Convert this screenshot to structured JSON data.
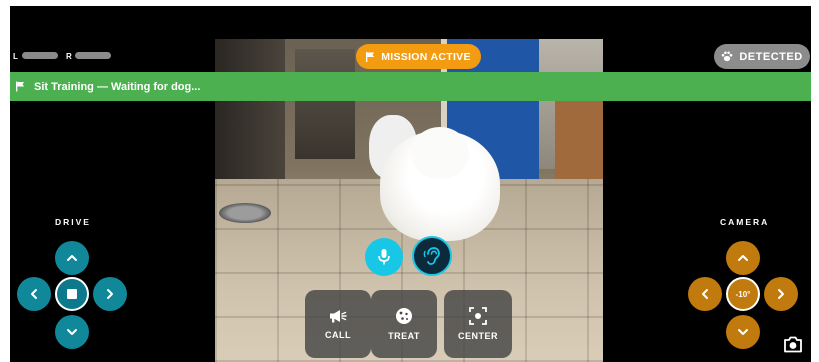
{
  "status": {
    "battery_left_label": "L",
    "battery_right_label": "R",
    "mission_badge": "MISSION ACTIVE",
    "detected_badge": "DETECTED",
    "banner_text": "Sit Training — Waiting for dog..."
  },
  "drive": {
    "label": "DRIVE"
  },
  "camera": {
    "label": "CAMERA",
    "tilt_value": "-10°"
  },
  "actions": {
    "call_label": "CALL",
    "treat_label": "TREAT",
    "center_label": "CENTER"
  },
  "icons": {
    "mission": "flag-icon",
    "detected": "paw-icon",
    "banner": "flag-icon",
    "mic": "microphone-icon",
    "listen": "ear-icon",
    "call": "megaphone-icon",
    "treat": "cookie-icon",
    "center": "crosshair-icon",
    "snapshot": "camera-icon"
  },
  "colors": {
    "mission_active": "#f39c12",
    "detected_inactive": "#8c8c8c",
    "banner_success": "#4caf50",
    "drive_accent": "#11879a",
    "camera_accent": "#c07a0e",
    "mic_accent": "#18c7e6"
  }
}
